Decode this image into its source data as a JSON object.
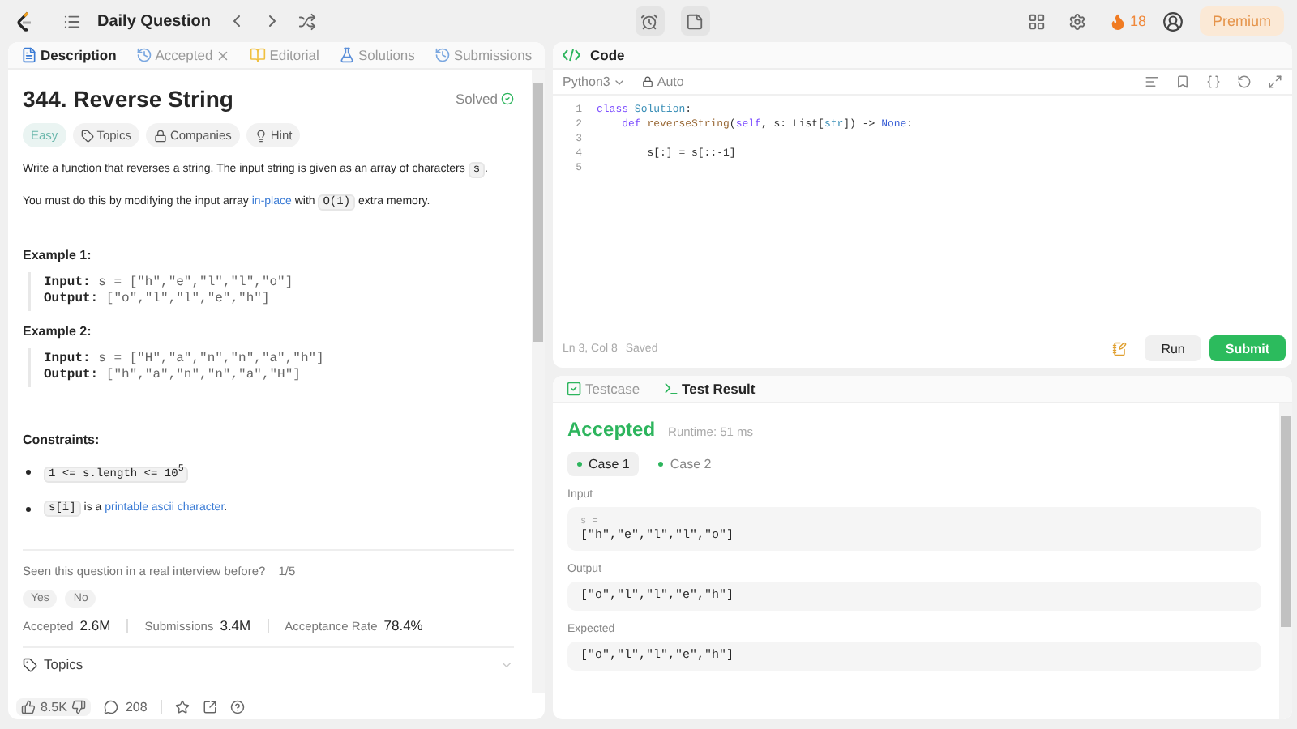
{
  "topbar": {
    "title": "Daily Question",
    "streak": "18",
    "premium": "Premium"
  },
  "problem": {
    "tabs": [
      {
        "label": "Description",
        "selected": true,
        "closable": false
      },
      {
        "label": "Accepted",
        "selected": false,
        "closable": true
      },
      {
        "label": "Editorial",
        "selected": false,
        "closable": false
      },
      {
        "label": "Solutions",
        "selected": false,
        "closable": false
      },
      {
        "label": "Submissions",
        "selected": false,
        "closable": false
      }
    ],
    "title": "344. Reverse String",
    "status": "Solved",
    "difficulty": "Easy",
    "tags": [
      {
        "label": "Topics"
      },
      {
        "label": "Companies"
      },
      {
        "label": "Hint"
      }
    ],
    "paragraphs": [
      [
        {
          "kind": "text",
          "text": "Write a function that reverses a string. The input string is given as an array of characters "
        },
        {
          "kind": "code",
          "text": "s"
        },
        {
          "kind": "text",
          "text": "."
        }
      ],
      [
        {
          "kind": "text",
          "text": "You must do this by modifying the input array "
        },
        {
          "kind": "link",
          "text": "in-place"
        },
        {
          "kind": "text",
          "text": " with "
        },
        {
          "kind": "code",
          "text": "O(1)"
        },
        {
          "kind": "text",
          "text": " extra memory."
        }
      ]
    ],
    "examples": [
      {
        "title": "Example 1:",
        "lines": [
          {
            "label": "Input:",
            "value": "s = [\"h\",\"e\",\"l\",\"l\",\"o\"]"
          },
          {
            "label": "Output:",
            "value": "[\"o\",\"l\",\"l\",\"e\",\"h\"]"
          }
        ]
      },
      {
        "title": "Example 2:",
        "lines": [
          {
            "label": "Input:",
            "value": "s = [\"H\",\"a\",\"n\",\"n\",\"a\",\"h\"]"
          },
          {
            "label": "Output:",
            "value": "[\"h\",\"a\",\"n\",\"n\",\"a\",\"H\"]"
          }
        ]
      }
    ],
    "constraints_title": "Constraints:",
    "constraints": [
      [
        {
          "kind": "code",
          "text": "1 <= s.length <= 10$^{5}$"
        }
      ],
      [
        {
          "kind": "code",
          "text": "s[i]"
        },
        {
          "kind": "text",
          "text": " is a "
        },
        {
          "kind": "link",
          "text": "printable ascii character"
        },
        {
          "kind": "text",
          "text": "."
        }
      ]
    ],
    "interview": {
      "question": "Seen this question in a real interview before?",
      "count": "1/5",
      "answers": [
        "Yes",
        "No"
      ]
    },
    "stats": [
      {
        "label": "Accepted",
        "value": "2.6M"
      },
      {
        "label": "Submissions",
        "value": "3.4M"
      },
      {
        "label": "Acceptance Rate",
        "value": "78.4%"
      }
    ],
    "topics_label": "Topics",
    "footer": {
      "likes": "8.5K",
      "comments": "208"
    }
  },
  "code": {
    "title": "Code",
    "language": "Python3",
    "mode": "Auto",
    "lines": [
      {
        "number": "1",
        "tokens": [
          {
            "kind": "keyword",
            "text": "class"
          },
          {
            "kind": "type",
            "text": " Solution"
          },
          {
            "kind": "plain",
            "text": ":"
          }
        ]
      },
      {
        "number": "2",
        "tokens": [
          {
            "kind": "keyword",
            "text": "    def"
          },
          {
            "kind": "fn",
            "text": " reverseString"
          },
          {
            "kind": "plain",
            "text": "("
          },
          {
            "kind": "keyword",
            "text": "self"
          },
          {
            "kind": "plain",
            "text": ", s: List["
          },
          {
            "kind": "type",
            "text": "str"
          },
          {
            "kind": "plain",
            "text": "]) -> "
          },
          {
            "kind": "const",
            "text": "None"
          },
          {
            "kind": "plain",
            "text": ":"
          }
        ]
      },
      {
        "number": "3"
      },
      {
        "number": "4",
        "tokens": [
          {
            "kind": "plain",
            "text": "        s[:] = s[::-1]"
          }
        ]
      },
      {
        "number": "5"
      }
    ],
    "cursor": "Ln 3, Col 8",
    "saved": "Saved",
    "run": "Run",
    "submit": "Submit"
  },
  "result": {
    "tabs": [
      {
        "label": "Testcase",
        "selected": false
      },
      {
        "label": "Test Result",
        "selected": true
      }
    ],
    "verdict": "Accepted",
    "runtime": "Runtime: 51 ms",
    "cases": [
      {
        "label": "Case 1",
        "selected": true
      },
      {
        "label": "Case 2",
        "selected": false
      }
    ],
    "sections": [
      {
        "label": "Input",
        "var": "s =",
        "value": "[\"h\",\"e\",\"l\",\"l\",\"o\"]"
      },
      {
        "label": "Output",
        "value": "[\"o\",\"l\",\"l\",\"e\",\"h\"]"
      },
      {
        "label": "Expected",
        "value": "[\"o\",\"l\",\"l\",\"e\",\"h\"]"
      }
    ]
  }
}
